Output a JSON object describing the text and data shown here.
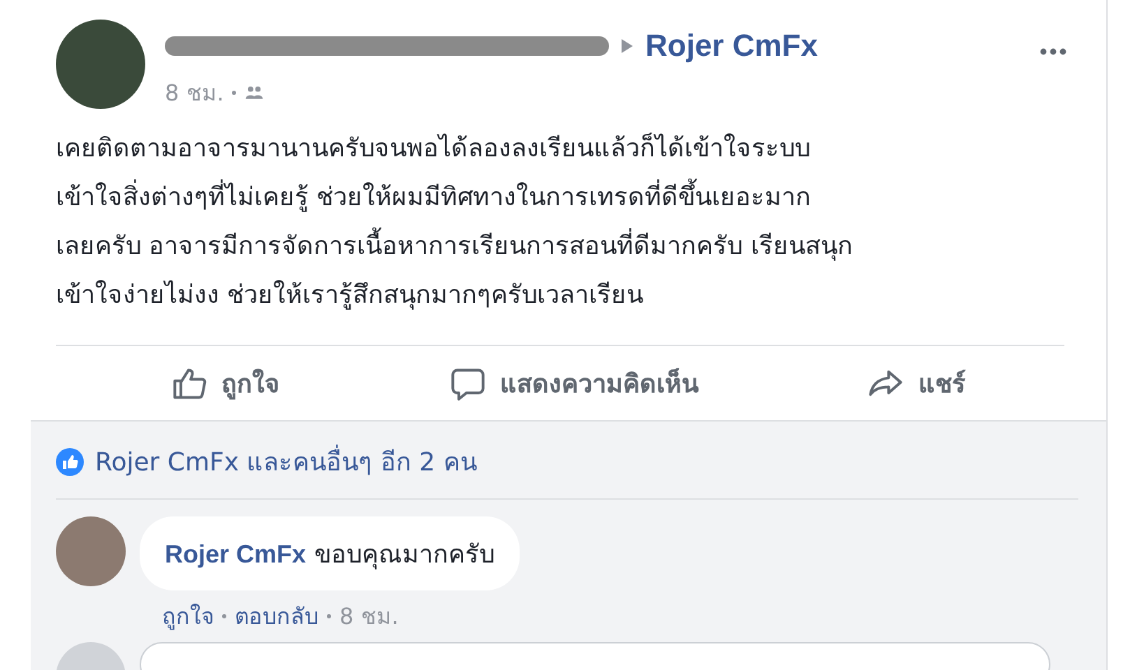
{
  "post": {
    "author_redacted": true,
    "target": "Rojer CmFx",
    "time": "8 ชม.",
    "text": "เคยติดตามอาจารมานานครับจนพอได้ลองลงเรียนแล้วก็ได้เข้าใจระบบ\nเข้าใจสิ่งต่างๆที่ไม่เคยรู้ ช่วยให้ผมมีทิศทางในการเทรดที่ดีขึ้นเยอะมาก\nเลยครับ อาจารมีการจัดการเนื้อหาการเรียนการสอนที่ดีมากครับ เรียนสนุก\nเข้าใจง่ายไม่งง ช่วยให้เรารู้สึกสนุกมากๆครับเวลาเรียน"
  },
  "actions": [
    {
      "kind": "like",
      "label": "ถูกใจ"
    },
    {
      "kind": "comment",
      "label": "แสดงความคิดเห็น"
    },
    {
      "kind": "share",
      "label": "แชร์"
    }
  ],
  "likes_summary": "Rojer CmFx และคนอื่นๆ อีก 2 คน",
  "comments": [
    {
      "author": "Rojer CmFx",
      "text": "ขอบคุณมากครับ",
      "actions": [
        "ถูกใจ",
        "ตอบกลับ"
      ],
      "time": "8 ชม."
    }
  ]
}
